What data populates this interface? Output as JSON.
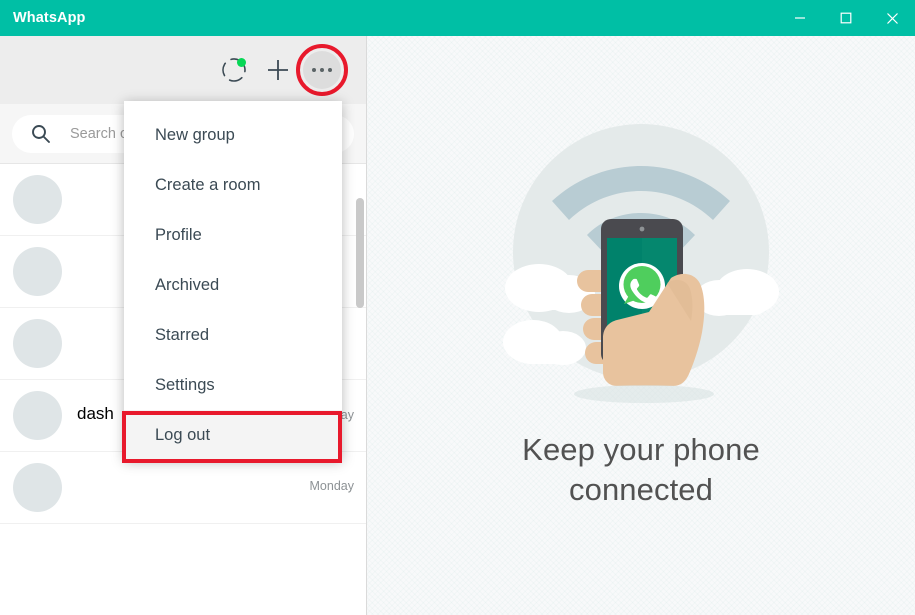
{
  "window": {
    "title": "WhatsApp",
    "controls": [
      {
        "name": "minimize",
        "glyph": "minimize-icon"
      },
      {
        "name": "maximize",
        "glyph": "maximize-icon"
      },
      {
        "name": "close",
        "glyph": "close-icon"
      }
    ],
    "titlebar_color": "#00bfa5"
  },
  "header": {
    "status_icon": "status-circle-icon",
    "new_chat_icon": "plus-icon",
    "menu_icon": "more-options-icon"
  },
  "search": {
    "icon": "search-icon",
    "placeholder": "Search or start a new chat",
    "visible_text": "Sea"
  },
  "menu": {
    "items": [
      {
        "label": "New group",
        "highlighted": false
      },
      {
        "label": "Create a room",
        "highlighted": false
      },
      {
        "label": "Profile",
        "highlighted": false
      },
      {
        "label": "Archived",
        "highlighted": false
      },
      {
        "label": "Starred",
        "highlighted": false
      },
      {
        "label": "Settings",
        "highlighted": false
      },
      {
        "label": "Log out",
        "highlighted": true
      }
    ]
  },
  "annotations": {
    "color": "#e8192c",
    "menu_button_circle": "highlights the three-dots menu button",
    "logout_box": "highlights the Log out menu item"
  },
  "chats": [
    {
      "name": "",
      "message": "",
      "time": ""
    },
    {
      "name": "",
      "message": "",
      "time": ""
    },
    {
      "name": "",
      "message": "",
      "time": ""
    },
    {
      "name": "dash",
      "message": "",
      "time": "Monday"
    },
    {
      "name": "",
      "message": "",
      "time": "Monday"
    }
  ],
  "intro": {
    "title_line1": "Keep your phone",
    "title_line2": "connected",
    "illustration": "phone-in-hand-wifi-illustration",
    "colors": {
      "circle": "#e4eaea",
      "wifi": "#b8ccd3",
      "cloud": "#ffffff",
      "phone_body": "#4a4a4f",
      "phone_screen": "#00826b",
      "logo": "#4fce5d",
      "hand": "#e8c39e"
    }
  }
}
